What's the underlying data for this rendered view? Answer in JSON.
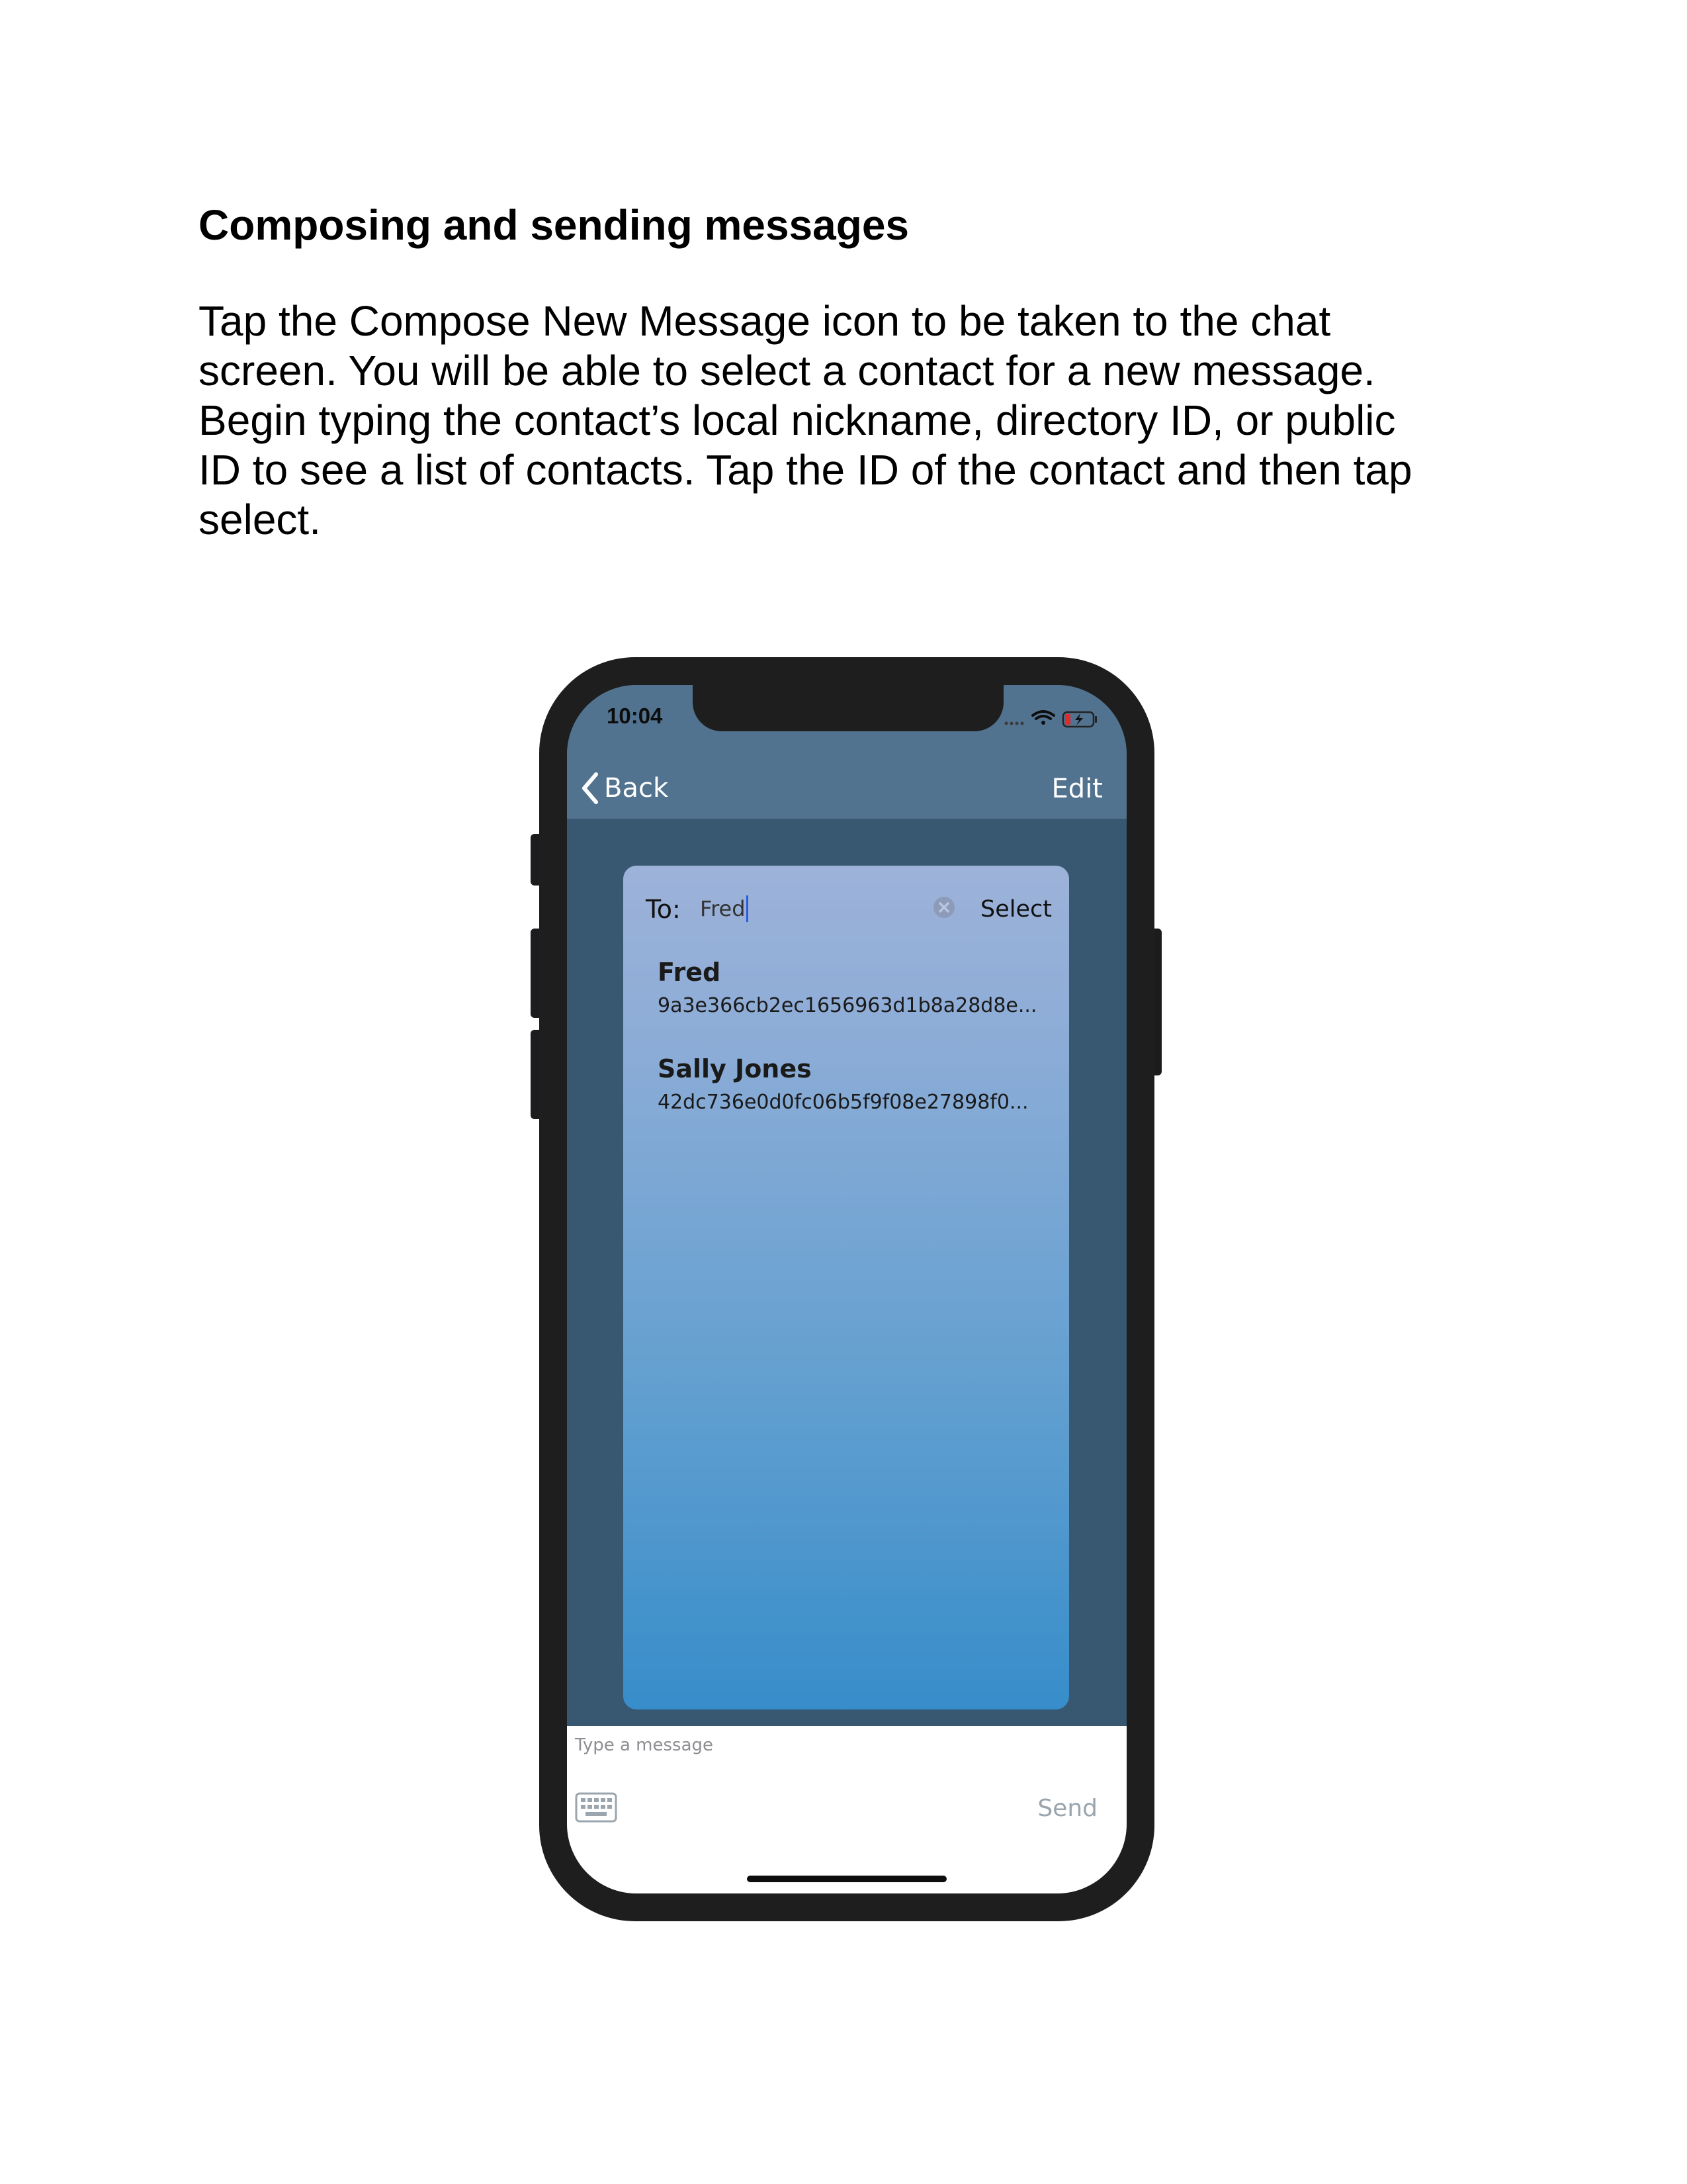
{
  "document": {
    "title": "Composing and sending messages",
    "body_lines": [
      "Tap the Compose New Message icon to be taken to the chat",
      "screen. You will be able to select a contact for a new message.",
      "Begin typing the contact’s local nickname, directory ID, or public",
      "ID to see a list of contacts. Tap the ID of the contact and then tap",
      "select."
    ]
  },
  "phone": {
    "status_bar": {
      "time": "10:04",
      "icons": [
        "signal-dots-icon",
        "wifi-icon",
        "battery-charging-icon"
      ]
    },
    "nav": {
      "back_label": "Back",
      "edit_label": "Edit"
    },
    "compose": {
      "to_label": "To:",
      "to_value": "Fred",
      "select_label": "Select",
      "contacts": [
        {
          "name": "Fred",
          "id": "9a3e366cb2ec1656963d1b8a28d8e..."
        },
        {
          "name": "Sally Jones",
          "id": "42dc736e0d0fc06b5f9f08e27898f0..."
        }
      ]
    },
    "message_input": {
      "placeholder": "Type a message",
      "send_label": "Send"
    }
  },
  "colors": {
    "nav_bar": "#52738f",
    "screen_background": "#385872",
    "card_gradient_top": "#9db2d9",
    "card_gradient_bottom": "#378dca",
    "frame": "#1e1e1e"
  }
}
